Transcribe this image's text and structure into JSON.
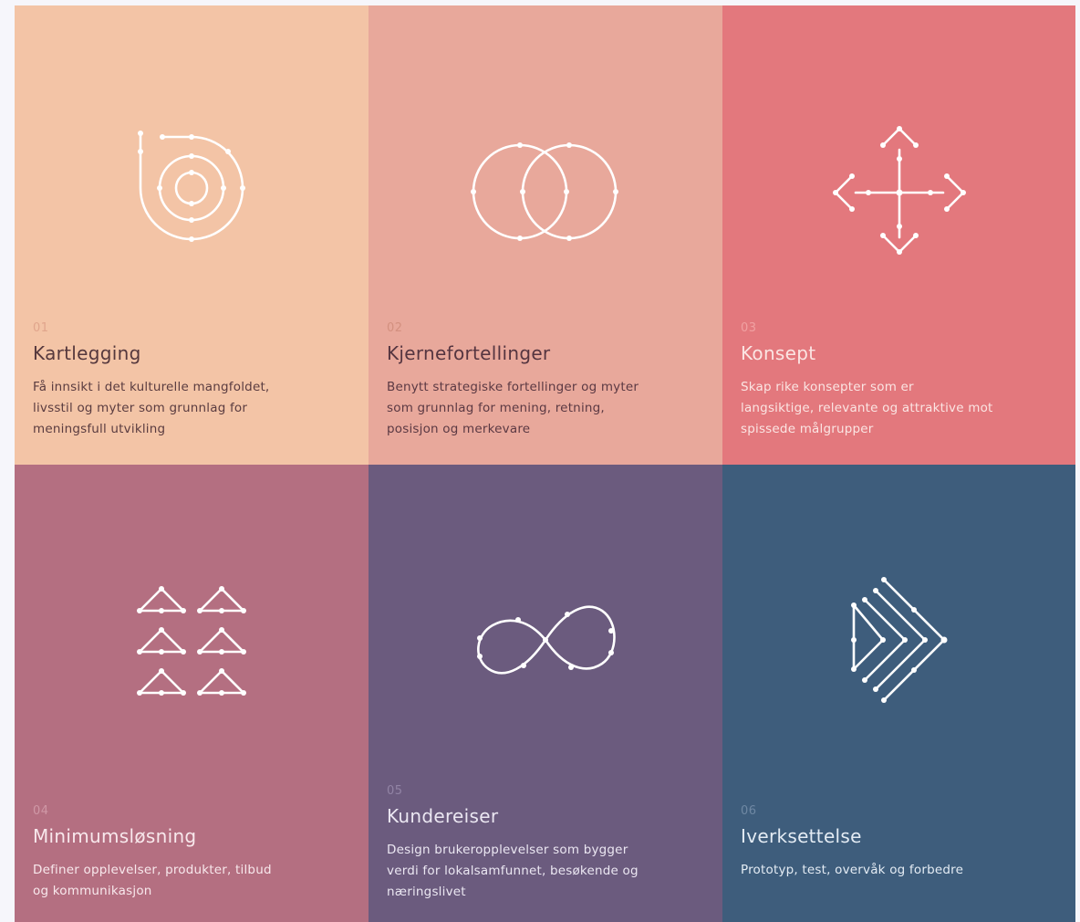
{
  "cards": [
    {
      "number": "01",
      "title": "Kartlegging",
      "desc_lines": [
        "Få innsikt i det kulturelle mangfoldet,",
        "livsstil og myter som grunnlag for",
        "meningsfull utvikling"
      ],
      "background": "#f3c4a6",
      "icon": "concentric-spiral-icon"
    },
    {
      "number": "02",
      "title": "Kjernefortellinger",
      "desc_lines": [
        "Benytt strategiske fortellinger og myter",
        "som grunnlag for mening, retning,",
        "posisjon og merkevare"
      ],
      "background": "#e8a89b",
      "icon": "overlapping-circles-icon"
    },
    {
      "number": "03",
      "title": "Konsept",
      "desc_lines": [
        "Skap rike konsepter som er",
        "langsiktige, relevante og attraktive mot",
        "spissede målgrupper"
      ],
      "background": "#e3787d",
      "icon": "four-way-arrows-icon"
    },
    {
      "number": "04",
      "title": "Minimumsløsning",
      "desc_lines": [
        "Definer opplevelser, produkter, tilbud",
        "og kommunikasjon"
      ],
      "background": "#b46f81",
      "icon": "triangles-grid-icon"
    },
    {
      "number": "05",
      "title": "Kundereiser",
      "desc_lines": [
        "Design brukeropplevelser som bygger",
        "verdi for lokalsamfunnet, besøkende og",
        "næringslivet"
      ],
      "background": "#6b5b7e",
      "icon": "infinity-icon"
    },
    {
      "number": "06",
      "title": "Iverksettelse",
      "desc_lines": [
        "Prototyp, test, overvåk og forbedre"
      ],
      "background": "#3e5d7c",
      "icon": "chevrons-forward-icon"
    }
  ]
}
